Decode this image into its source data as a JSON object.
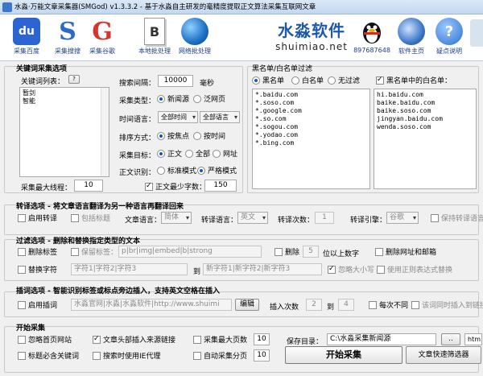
{
  "window": {
    "title": "水淼·万能文章采集器(SMGod) v1.3.3.2 - 基于水淼自主研发的毫精度提取正文算法采集互联网文章"
  },
  "toolbar": {
    "items": [
      {
        "label": "采集百度",
        "icon": "baidu-icon",
        "glyph": "du"
      },
      {
        "label": "采集搜搜",
        "icon": "soso-icon",
        "glyph": "S"
      },
      {
        "label": "采集谷歌",
        "icon": "google-icon",
        "glyph": "G"
      },
      {
        "label": "本地批处理",
        "icon": "document-icon",
        "glyph": "B"
      },
      {
        "label": "网络批处理",
        "icon": "globe-icon",
        "glyph": ""
      },
      {
        "label": "897687648",
        "icon": "qq-penguin-icon",
        "glyph": ""
      },
      {
        "label": "软件主页",
        "icon": "speed-globe-icon",
        "glyph": ""
      },
      {
        "label": "疑点说明",
        "icon": "help-icon",
        "glyph": "?"
      }
    ],
    "brand_cn": "水淼软件",
    "brand_en": "shuimiao.net"
  },
  "keyword": {
    "section_title": "关键词采集选项",
    "list_label": "关键词列表：",
    "help": "?",
    "list": [
      "暂剑",
      "智能"
    ],
    "max_threads_label": "采集最大线程：",
    "max_threads": "10",
    "interval_label": "搜索间隔：",
    "interval": "10000",
    "interval_unit": "毫秒",
    "type_label": "采集类型：",
    "type_opt1": "新闻源",
    "type_opt2": "泛网页",
    "lang_label": "时间语言：",
    "time_select": "全部时间",
    "lang_select": "全部语言",
    "sort_label": "排序方式：",
    "sort_opt1": "按焦点",
    "sort_opt2": "按时间",
    "target_label": "采集目标：",
    "target_opt1": "正文",
    "target_opt2": "全部",
    "target_opt3": "网址",
    "recog_label": "正文识别：",
    "recog_opt1": "标准模式",
    "recog_opt2": "严格模式",
    "min_words_label": "正文最少字数：",
    "min_words": "150"
  },
  "filterlist": {
    "title": "黑名单/白名单过滤",
    "opt_black": "黑名单",
    "opt_white": "白名单",
    "opt_none": "无过滤",
    "whitelist_in_black_label": "黑名单中的白名单：",
    "black": [
      "*.baidu.com",
      "*.soso.com",
      "*.google.com",
      "*.so.com",
      "*.sogou.com",
      "*.yodao.com",
      "*.bing.com"
    ],
    "white": [
      "hi.baidu.com",
      "baike.baidu.com",
      "baike.soso.com",
      "jingyan.baidu.com",
      "wenda.soso.com"
    ]
  },
  "translate": {
    "title": "转译选项 - 将文章语言翻译为另一种语言再翻译回来",
    "enable": "启用转译",
    "include_title": "包括标题",
    "article_lang_label": "文章语言：",
    "article_lang": "简体",
    "trans_lang_label": "转译语言：",
    "trans_lang": "英文",
    "times_label": "转译次数：",
    "times": "1",
    "engine_label": "转译引擎：",
    "engine": "谷歌",
    "keep_lang": "保持转译语言"
  },
  "filter": {
    "title": "过滤选项 - 删除和替换指定类型的文本",
    "delete_tags": "删除标签",
    "keep_tags_label": "保留标签：",
    "keep_tags": "p|br|img|embed|b|strong",
    "delete": "删除",
    "delete_num": "5",
    "digits_below": "位以上数字",
    "delete_urls": "删除网址和邮箱",
    "replace_chars": "替换字符",
    "replace_from": "字符1|字符2|字符3",
    "to": "到",
    "replace_to": "新字符1|新字符2|新字符3",
    "ignore_case": "忽略大小写",
    "use_regex": "使用正则表达式替换"
  },
  "insert": {
    "title": "插词选项 - 智能识别标签或标点旁边插入，支持英文空格在插入",
    "enable": "启用插词",
    "words": "水淼官网|水淼|水淼软件|http://www.shuimi",
    "edit": "编辑",
    "count_label": "插入次数",
    "count_from": "2",
    "to": "到",
    "count_to": "4",
    "diff_each": "每次不同",
    "same_link_suffix": "该词同时插入到链接"
  },
  "start": {
    "title": "开始采集",
    "ignore_homepage": "忽略首页网站",
    "insert_source": "文章头部插入来源链接",
    "max_pages_label": "采集最大页数",
    "max_pages": "10",
    "keyword_must": "标题必含关键词",
    "use_ie_proxy": "搜索时使用IE代理",
    "auto_pages_label": "自动采集分页",
    "auto_pages": "10",
    "save_dir_label": "保存目录：",
    "save_dir": "C:\\水淼采集新闻源",
    "browse": "..",
    "start_button": "开始采集",
    "selector_button": "文章快速筛选器",
    "ext_hint": "htm"
  }
}
